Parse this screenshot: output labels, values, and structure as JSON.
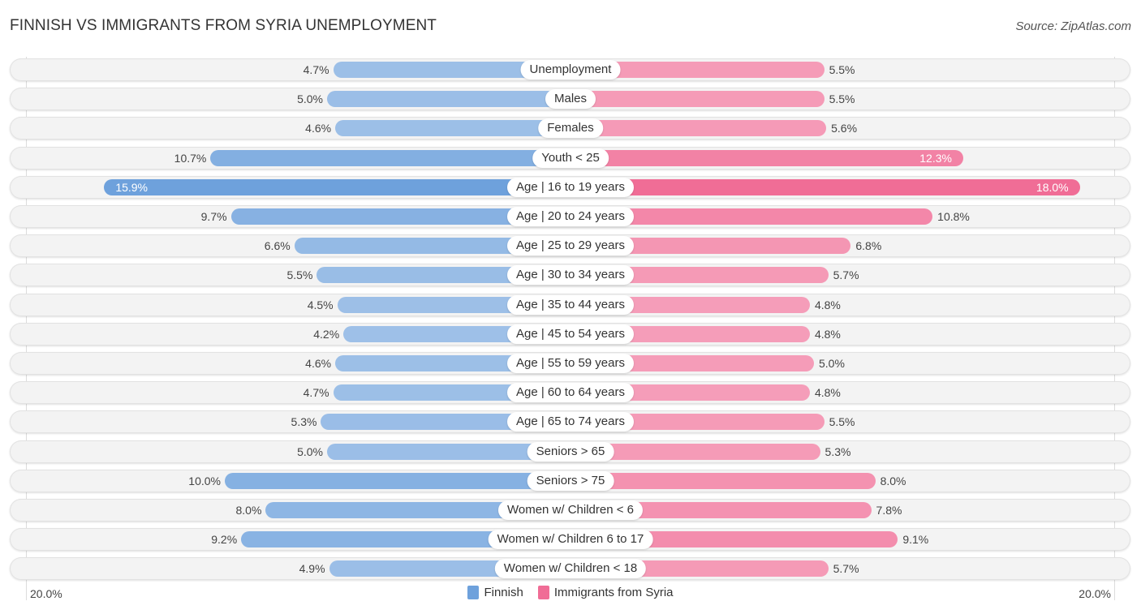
{
  "chart_data": {
    "type": "bar",
    "orientation": "diverging-horizontal",
    "title": "FINNISH VS IMMIGRANTS FROM SYRIA UNEMPLOYMENT",
    "source": "Source: ZipAtlas.com",
    "axis_min_label": "20.0%",
    "axis_max_label": "20.0%",
    "xlim": [
      0,
      20
    ],
    "legend_position": "bottom-center",
    "categories": [
      "Unemployment",
      "Males",
      "Females",
      "Youth < 25",
      "Age | 16 to 19 years",
      "Age | 20 to 24 years",
      "Age | 25 to 29 years",
      "Age | 30 to 34 years",
      "Age | 35 to 44 years",
      "Age | 45 to 54 years",
      "Age | 55 to 59 years",
      "Age | 60 to 64 years",
      "Age | 65 to 74 years",
      "Seniors > 65",
      "Seniors > 75",
      "Women w/ Children < 6",
      "Women w/ Children 6 to 17",
      "Women w/ Children < 18"
    ],
    "series": [
      {
        "name": "Finnish",
        "color": "#6ea1dc",
        "side": "left",
        "values": [
          4.7,
          5.0,
          4.6,
          10.7,
          15.9,
          9.7,
          6.6,
          5.5,
          4.5,
          4.2,
          4.6,
          4.7,
          5.3,
          5.0,
          10.0,
          8.0,
          9.2,
          4.9
        ],
        "labels": [
          "4.7%",
          "5.0%",
          "4.6%",
          "10.7%",
          "15.9%",
          "9.7%",
          "6.6%",
          "5.5%",
          "4.5%",
          "4.2%",
          "4.6%",
          "4.7%",
          "5.3%",
          "5.0%",
          "10.0%",
          "8.0%",
          "9.2%",
          "4.9%"
        ]
      },
      {
        "name": "Immigrants from Syria",
        "color": "#f06d96",
        "side": "right",
        "values": [
          5.5,
          5.5,
          5.6,
          12.3,
          18.0,
          10.8,
          6.8,
          5.7,
          4.8,
          4.8,
          5.0,
          4.8,
          5.5,
          5.3,
          8.0,
          7.8,
          9.1,
          5.7
        ],
        "labels": [
          "5.5%",
          "5.5%",
          "5.6%",
          "12.3%",
          "18.0%",
          "10.8%",
          "6.8%",
          "5.7%",
          "4.8%",
          "4.8%",
          "5.0%",
          "4.8%",
          "5.5%",
          "5.3%",
          "8.0%",
          "7.8%",
          "9.1%",
          "5.7%"
        ]
      }
    ]
  }
}
